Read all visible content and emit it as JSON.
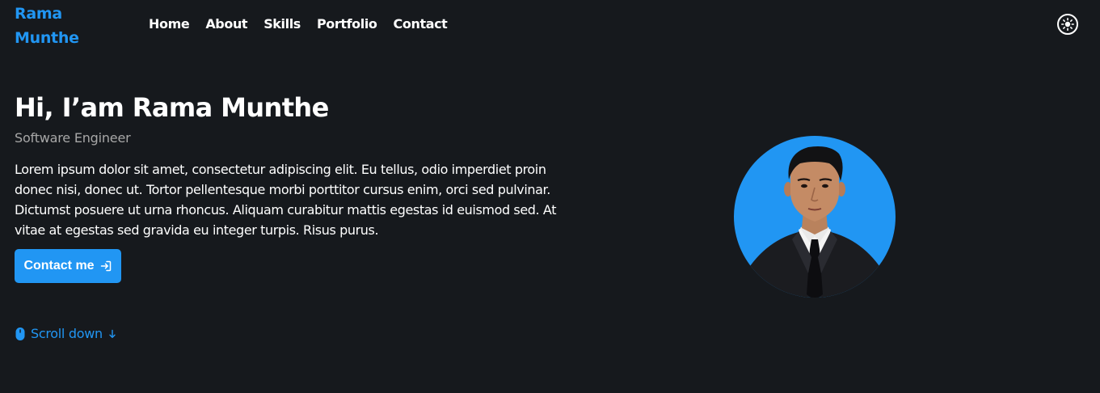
{
  "header": {
    "brand": "Rama Munthe",
    "nav": [
      {
        "label": "Home"
      },
      {
        "label": "About"
      },
      {
        "label": "Skills"
      },
      {
        "label": "Portfolio"
      },
      {
        "label": "Contact"
      }
    ],
    "theme_toggle_icon": "sun-icon"
  },
  "hero": {
    "title": "Hi, I’am Rama Munthe",
    "subtitle": "Software Engineer",
    "description": "Lorem ipsum dolor sit amet, consectetur adipiscing elit. Eu tellus, odio imperdiet proin donec nisi, donec ut. Tortor pellentesque morbi porttitor cursus enim, orci sed pulvinar. Dictumst posuere ut urna rhoncus. Aliquam curabitur mattis egestas id euismod sed. At vitae at egestas sed gravida eu integer turpis. Risus purus.",
    "contact_button": "Contact me",
    "contact_icon": "login-icon",
    "scroll_down": "Scroll down",
    "scroll_icon": "mouse-icon",
    "scroll_arrow_icon": "arrow-down-icon",
    "avatar_icon": "profile-photo"
  },
  "colors": {
    "background": "#16191d",
    "accent": "#2196f3",
    "text": "#ffffff",
    "muted": "#a7a7a7"
  }
}
